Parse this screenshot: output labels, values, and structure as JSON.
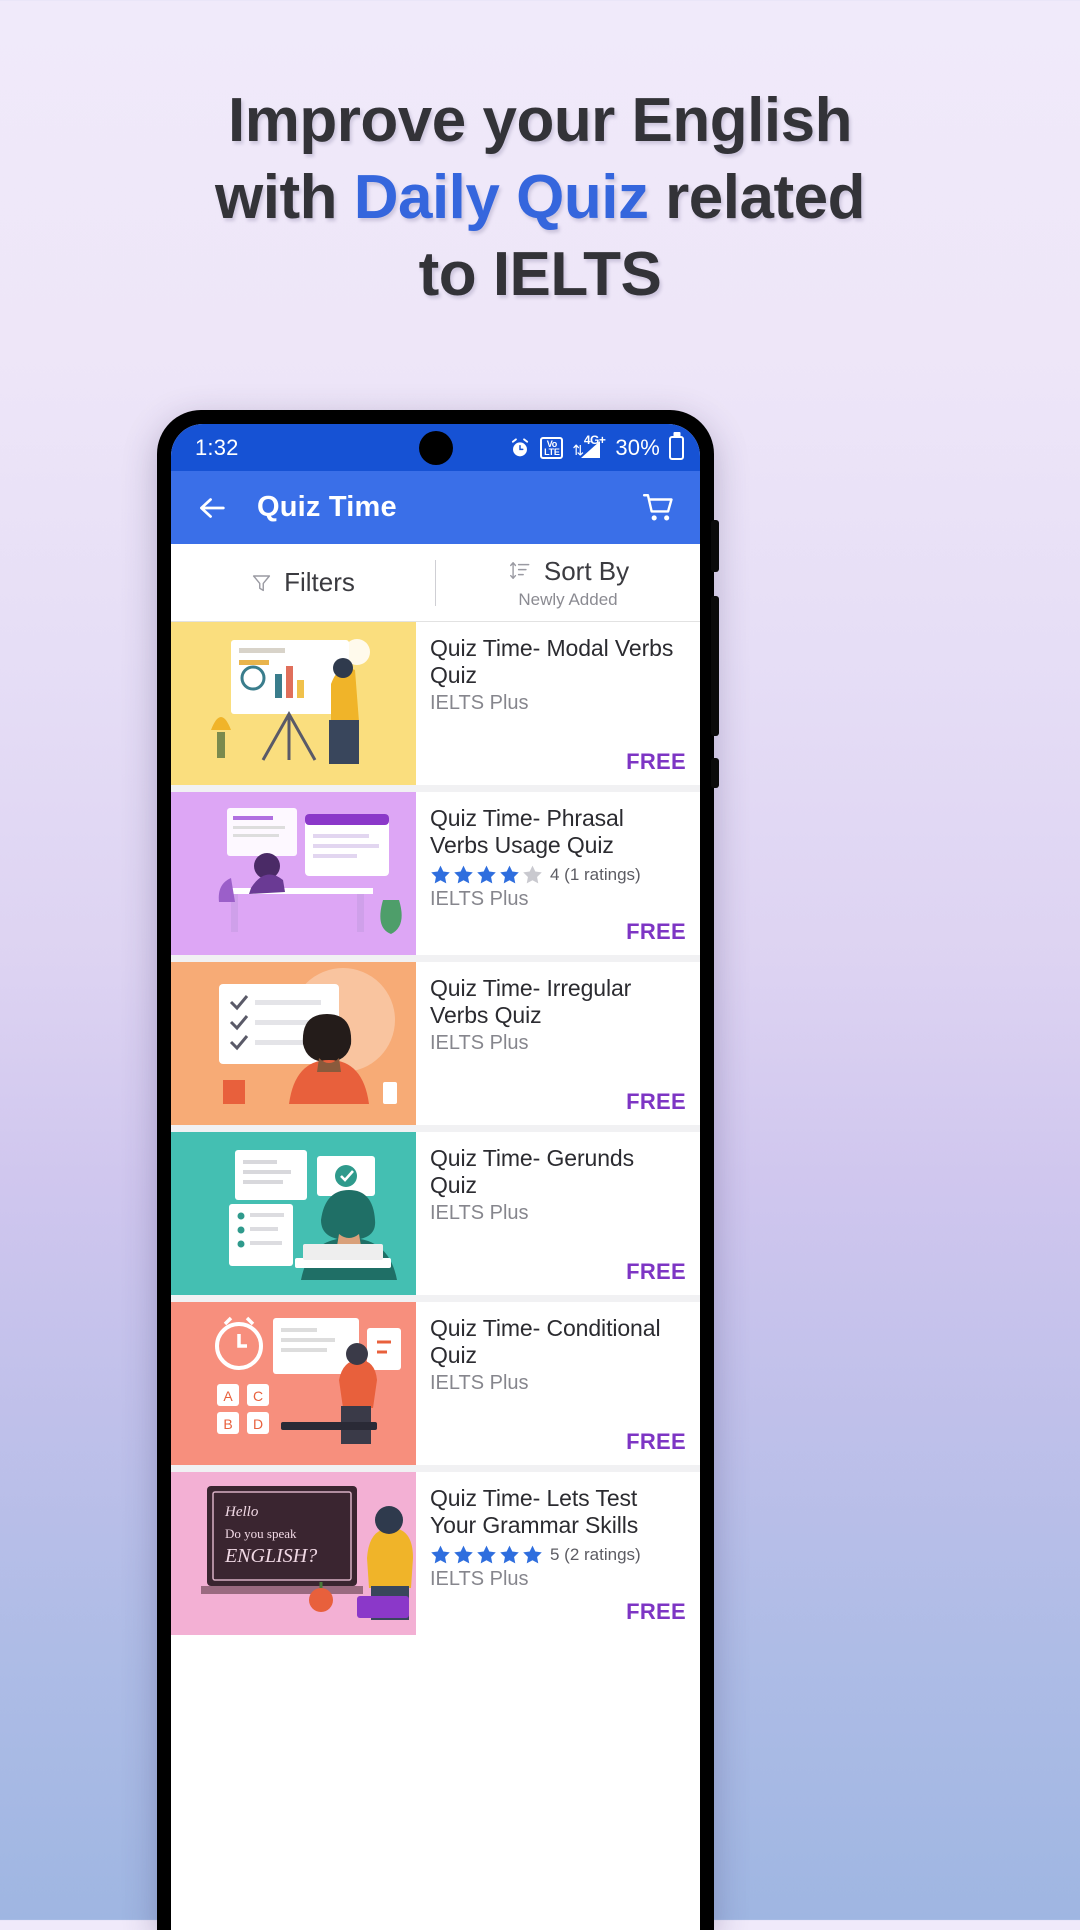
{
  "promo": {
    "line1": "Improve your English",
    "line2_prefix": "with ",
    "line2_accent": "Daily Quiz",
    "line2_suffix": " related",
    "line3": "to IELTS",
    "accent_color": "#3566dd",
    "text_color": "#333338"
  },
  "status_bar": {
    "time": "1:32",
    "alarm_icon": "alarm-clock-icon",
    "volte_top": "Vo",
    "volte_bottom": "LTE",
    "network": "4G+",
    "battery_percent": "30%",
    "battery_icon": "battery-icon",
    "background": "#1652d4"
  },
  "app_bar": {
    "back_icon": "back-arrow-icon",
    "title": "Quiz Time",
    "cart_icon": "shopping-cart-icon",
    "background": "#3a6fe8"
  },
  "filter_bar": {
    "filters": {
      "label": "Filters",
      "icon": "funnel-icon"
    },
    "sort": {
      "label": "Sort By",
      "value": "Newly Added",
      "icon": "sort-icon"
    }
  },
  "quizzes": [
    {
      "title": "Quiz Time- Modal Verbs Quiz",
      "publisher": "IELTS Plus",
      "price": "FREE",
      "rating": null,
      "rating_text": null,
      "thumb_color": "#fade7e",
      "thumb_theme": "presentation"
    },
    {
      "title": "Quiz Time- Phrasal Verbs Usage Quiz",
      "publisher": "IELTS Plus",
      "price": "FREE",
      "rating": 4,
      "rating_text": "4 (1 ratings)",
      "thumb_color": "#dda6f5",
      "thumb_theme": "desk"
    },
    {
      "title": "Quiz Time- Irregular Verbs Quiz",
      "publisher": "IELTS Plus",
      "price": "FREE",
      "rating": null,
      "rating_text": null,
      "thumb_color": "#f7ab76",
      "thumb_theme": "whiteboard"
    },
    {
      "title": "Quiz Time- Gerunds Quiz",
      "publisher": "IELTS Plus",
      "price": "FREE",
      "rating": null,
      "rating_text": null,
      "thumb_color": "#44bfb2",
      "thumb_theme": "laptop"
    },
    {
      "title": "Quiz Time- Conditional Quiz",
      "publisher": "IELTS Plus",
      "price": "FREE",
      "rating": null,
      "rating_text": null,
      "thumb_color": "#f78f7d",
      "thumb_theme": "monitors"
    },
    {
      "title": "Quiz Time- Lets Test Your Grammar Skills",
      "publisher": "IELTS Plus",
      "price": "FREE",
      "rating": 5,
      "rating_text": "5 (2 ratings)",
      "thumb_color": "#f3b0d4",
      "thumb_theme": "blackboard"
    }
  ],
  "colors": {
    "star_filled": "#2f6ede",
    "star_empty": "#c9c9cf",
    "price": "#7d35c4"
  }
}
